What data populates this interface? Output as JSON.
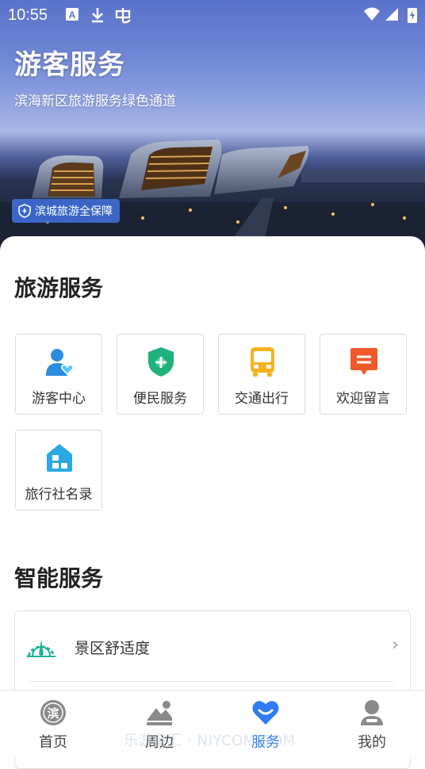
{
  "status_bar": {
    "time": "10:55"
  },
  "hero": {
    "title": "游客服务",
    "subtitle": "滨海新区旅游服务绿色通道",
    "badge": "滨城旅游全保障"
  },
  "tourism_services": {
    "title": "旅游服务",
    "items": [
      {
        "label": "游客中心",
        "icon": "tourist-center-icon",
        "color": "#2b8de0"
      },
      {
        "label": "便民服务",
        "icon": "shield-plus-icon",
        "color": "#1fb27a"
      },
      {
        "label": "交通出行",
        "icon": "bus-icon",
        "color": "#f5b21f"
      },
      {
        "label": "欢迎留言",
        "icon": "message-icon",
        "color": "#f05a28"
      },
      {
        "label": "旅行社名录",
        "icon": "agency-directory-icon",
        "color": "#2aa8e6"
      }
    ]
  },
  "smart_services": {
    "title": "智能服务",
    "items": [
      {
        "label": "景区舒适度",
        "icon": "comfort-gauge-icon"
      }
    ]
  },
  "tab_bar": {
    "items": [
      {
        "label": "首页",
        "icon": "home-icon",
        "active": false
      },
      {
        "label": "周边",
        "icon": "nearby-icon",
        "active": false
      },
      {
        "label": "服务",
        "icon": "heart-service-icon",
        "active": true
      },
      {
        "label": "我的",
        "icon": "profile-icon",
        "active": false
      }
    ],
    "accent": "#2f7cf6"
  },
  "watermark": "乐游宝汇 · NIYCOM.COM"
}
